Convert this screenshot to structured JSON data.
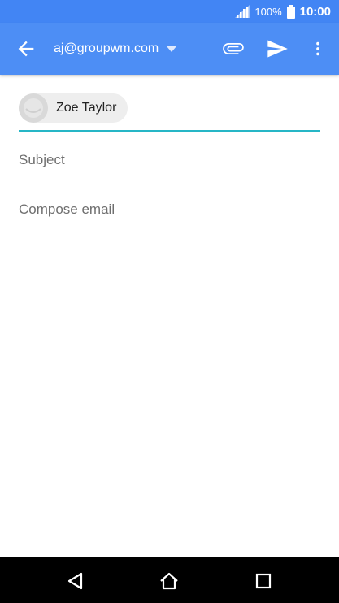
{
  "status_bar": {
    "battery_percent": "100%",
    "time": "10:00",
    "icons": [
      "signal-icon",
      "battery-icon"
    ]
  },
  "app_bar": {
    "account": "aj@groupwm.com",
    "icons": [
      "back-arrow-icon",
      "dropdown-caret-icon",
      "attach-icon",
      "send-icon",
      "more-vert-icon"
    ]
  },
  "compose": {
    "recipient_name": "Zoe Taylor",
    "subject_placeholder": "Subject",
    "subject_value": "",
    "body_placeholder": "Compose email",
    "body_value": ""
  },
  "nav_bar": {
    "icons": [
      "nav-back-icon",
      "nav-home-icon",
      "nav-recents-icon"
    ]
  },
  "colors": {
    "app_bar": "#4d8ef5",
    "status_bar": "#4285f4",
    "focus_underline": "#26b6c6"
  }
}
